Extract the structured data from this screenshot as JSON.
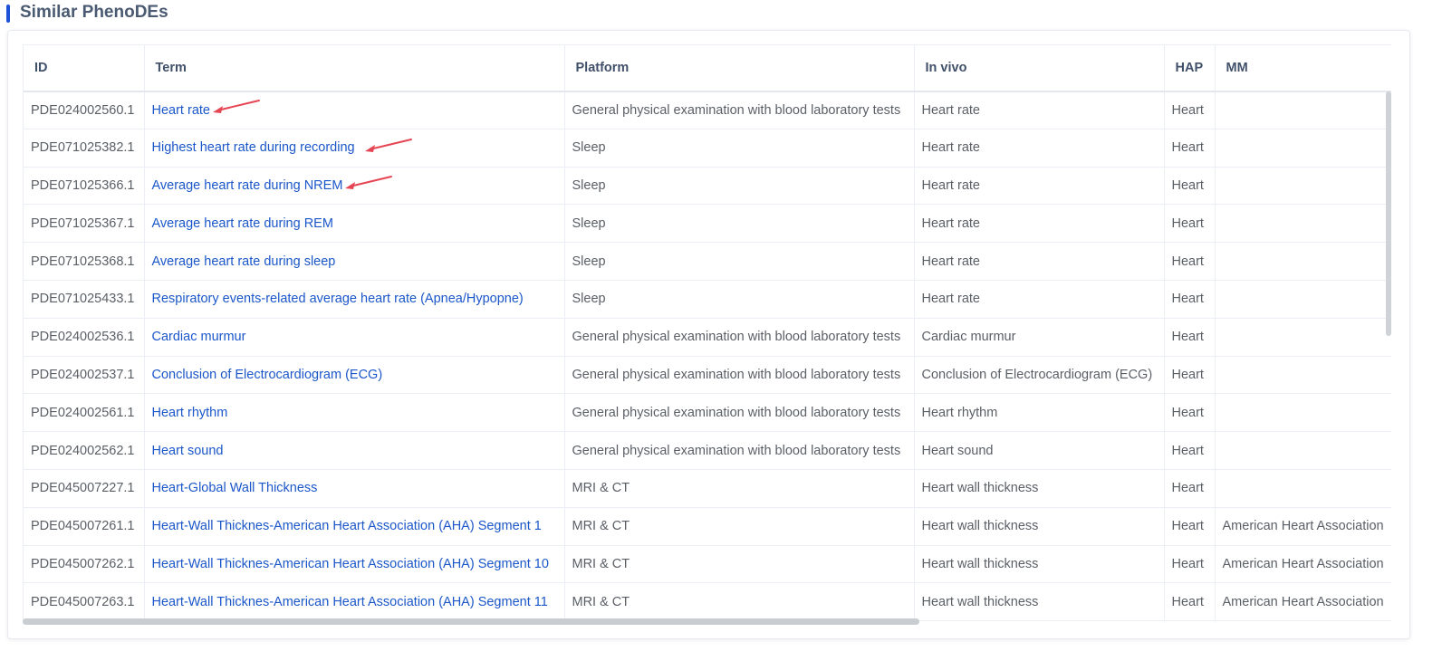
{
  "section": {
    "title": "Similar PhenoDEs"
  },
  "table": {
    "columns": [
      "ID",
      "Term",
      "Platform",
      "In vivo",
      "HAP",
      "MM"
    ],
    "rows": [
      {
        "id": "PDE024002560.1",
        "term": "Heart rate",
        "platform": "General physical examination with blood laboratory tests",
        "invivo": "Heart rate",
        "hap": "Heart",
        "mm": ""
      },
      {
        "id": "PDE071025382.1",
        "term": "Highest heart rate during recording",
        "platform": "Sleep",
        "invivo": "Heart rate",
        "hap": "Heart",
        "mm": ""
      },
      {
        "id": "PDE071025366.1",
        "term": "Average heart rate during NREM",
        "platform": "Sleep",
        "invivo": "Heart rate",
        "hap": "Heart",
        "mm": ""
      },
      {
        "id": "PDE071025367.1",
        "term": "Average heart rate during REM",
        "platform": "Sleep",
        "invivo": "Heart rate",
        "hap": "Heart",
        "mm": ""
      },
      {
        "id": "PDE071025368.1",
        "term": "Average heart rate during sleep",
        "platform": "Sleep",
        "invivo": "Heart rate",
        "hap": "Heart",
        "mm": ""
      },
      {
        "id": "PDE071025433.1",
        "term": "Respiratory events-related average heart rate (Apnea/Hypopne)",
        "platform": "Sleep",
        "invivo": "Heart rate",
        "hap": "Heart",
        "mm": ""
      },
      {
        "id": "PDE024002536.1",
        "term": "Cardiac murmur",
        "platform": "General physical examination with blood laboratory tests",
        "invivo": "Cardiac murmur",
        "hap": "Heart",
        "mm": ""
      },
      {
        "id": "PDE024002537.1",
        "term": "Conclusion of Electrocardiogram (ECG)",
        "platform": "General physical examination with blood laboratory tests",
        "invivo": "Conclusion of Electrocardiogram (ECG)",
        "hap": "Heart",
        "mm": ""
      },
      {
        "id": "PDE024002561.1",
        "term": "Heart rhythm",
        "platform": "General physical examination with blood laboratory tests",
        "invivo": "Heart rhythm",
        "hap": "Heart",
        "mm": ""
      },
      {
        "id": "PDE024002562.1",
        "term": "Heart sound",
        "platform": "General physical examination with blood laboratory tests",
        "invivo": "Heart sound",
        "hap": "Heart",
        "mm": ""
      },
      {
        "id": "PDE045007227.1",
        "term": "Heart-Global Wall Thickness",
        "platform": "MRI & CT",
        "invivo": "Heart wall thickness",
        "hap": "Heart",
        "mm": ""
      },
      {
        "id": "PDE045007261.1",
        "term": "Heart-Wall Thicknes-American Heart Association (AHA) Segment 1",
        "platform": "MRI & CT",
        "invivo": "Heart wall thickness",
        "hap": "Heart",
        "mm": "American Heart Association"
      },
      {
        "id": "PDE045007262.1",
        "term": "Heart-Wall Thicknes-American Heart Association (AHA) Segment 10",
        "platform": "MRI & CT",
        "invivo": "Heart wall thickness",
        "hap": "Heart",
        "mm": "American Heart Association"
      },
      {
        "id": "PDE045007263.1",
        "term": "Heart-Wall Thicknes-American Heart Association (AHA) Segment 11",
        "platform": "MRI & CT",
        "invivo": "Heart wall thickness",
        "hap": "Heart",
        "mm": "American Heart Association"
      }
    ]
  },
  "colors": {
    "accent": "#1d51d6",
    "link": "#1b57c9",
    "annotation_arrow": "#e64553"
  },
  "annotations": {
    "arrow_icon": "red-arrow-icon"
  }
}
